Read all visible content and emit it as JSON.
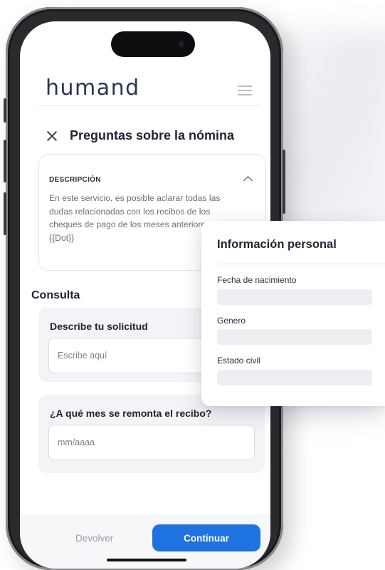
{
  "app": {
    "logo": "humand"
  },
  "header": {
    "title": "Preguntas sobre la nómina"
  },
  "description": {
    "heading": "DESCRIPCIÓN",
    "text": "En este servicio, es posible aclarar todas las dudas relacionadas con los recibos de los cheques de pago de los meses anteriores {{Dot}}"
  },
  "query": {
    "title": "Consulta",
    "field1": {
      "label": "Describe tu solicitud",
      "placeholder": "Escribe aquí"
    },
    "field2": {
      "label": "¿A qué mes se remonta el recibo?",
      "placeholder": "mm/aaaa"
    }
  },
  "footer": {
    "back_label": "Devolver",
    "continue_label": "Continuar"
  },
  "info_card": {
    "title": "Información personal",
    "fields": [
      {
        "label": "Fecha de nacimiento"
      },
      {
        "label": "Genero"
      },
      {
        "label": "Estado civil"
      }
    ]
  },
  "colors": {
    "primary": "#1e73e0",
    "logo": "#2c3354"
  }
}
